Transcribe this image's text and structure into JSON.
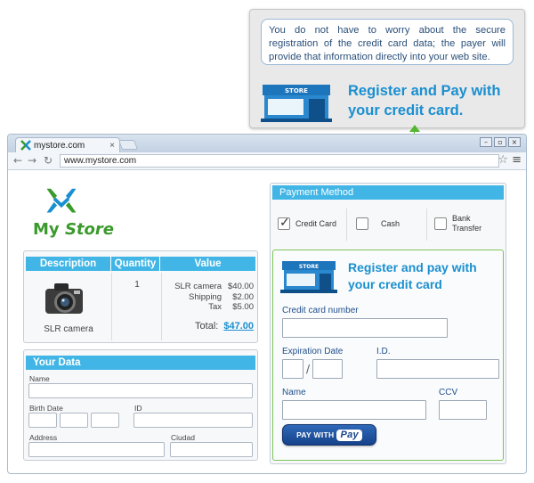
{
  "callout": {
    "note": "You do not have to worry about the secure registration of the credit card data; the payer will provide that information directly into your web site.",
    "title": "Register and Pay with your credit card.",
    "store_sign": "STORE"
  },
  "browser": {
    "tab_title": "mystore.com",
    "tab_close": "×",
    "url": "www.mystore.com",
    "back_icon": "back-arrow-icon",
    "forward_icon": "forward-arrow-icon",
    "reload_icon": "reload-icon",
    "star_icon": "star-icon",
    "menu_icon": "menu-icon"
  },
  "logo": {
    "word1": "My",
    "word2": "Store",
    "colors": [
      "#3a9a2b",
      "#1a8fd0"
    ]
  },
  "order": {
    "headers": [
      "Description",
      "Quantity",
      "Value"
    ],
    "item": "SLR camera",
    "quantity": "1",
    "lines": [
      {
        "label": "SLR camera",
        "amount": "$40.00"
      },
      {
        "label": "Shipping",
        "amount": "$2.00"
      },
      {
        "label": "Tax",
        "amount": "$5.00"
      }
    ],
    "total_label": "Total:",
    "total_amount": "$47.00"
  },
  "your_data": {
    "title": "Your Data",
    "name": "Name",
    "birth_date": "Birth Date",
    "id": "ID",
    "address": "Address",
    "city": "Ciudad"
  },
  "payment": {
    "title": "Payment Method",
    "methods": [
      {
        "label": "Credit Card",
        "checked": true
      },
      {
        "label": "Cash",
        "checked": false
      },
      {
        "label": "Bank Transfer",
        "checked": false
      }
    ],
    "cc_title": "Register and pay with your credit card",
    "store_sign": "STORE",
    "cc_number": "Credit card number",
    "expiration": "Expiration Date",
    "id": "I.D.",
    "name": "Name",
    "ccv": "CCV",
    "button_text": "PAY WITH",
    "button_brand": "Pay"
  },
  "colors": {
    "accent": "#41b6e6",
    "title_blue": "#1a8fd0",
    "connector": "#52b830"
  }
}
